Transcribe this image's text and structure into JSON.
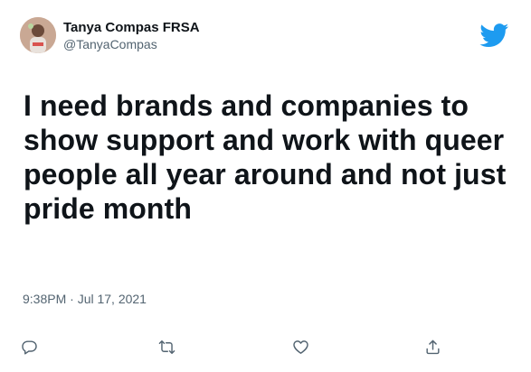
{
  "author": {
    "display_name": "Tanya Compas FRSA",
    "handle": "@TanyaCompas"
  },
  "tweet": {
    "text": "I need brands and companies to show support and work with queer people all year around and not just pride month",
    "timestamp": "9:38PM · Jul 17, 2021"
  },
  "brand": {
    "icon": "twitter-bird-icon",
    "color": "#1d9bf0"
  },
  "actions": [
    {
      "name": "reply",
      "icon": "reply-icon"
    },
    {
      "name": "retweet",
      "icon": "retweet-icon"
    },
    {
      "name": "like",
      "icon": "heart-icon"
    },
    {
      "name": "share",
      "icon": "share-icon"
    }
  ],
  "colors": {
    "text": "#0f1419",
    "secondary": "#536471"
  }
}
